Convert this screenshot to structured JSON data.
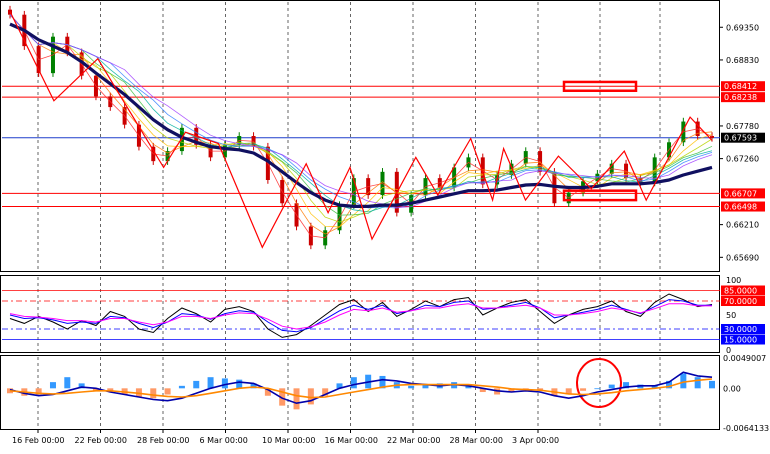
{
  "chart_data": [
    {
      "type": "line",
      "pane": "price",
      "ylim": [
        0.6552,
        0.6972
      ],
      "y_ticks": [
        "0.69350",
        "0.68830",
        "0.67780",
        "0.67260",
        "0.66210",
        "0.65690"
      ],
      "horizontal_levels": [
        {
          "label": "0.68412",
          "value": 0.68412,
          "color": "#ff0000"
        },
        {
          "label": "0.68238",
          "value": 0.68238,
          "color": "#ff0000"
        },
        {
          "label": "0.67593",
          "value": 0.67593,
          "color": "#000000"
        },
        {
          "label": "0.66707",
          "value": 0.66707,
          "color": "#ff0000"
        },
        {
          "label": "0.66498",
          "value": 0.66498,
          "color": "#ff0000"
        }
      ],
      "x": [
        0,
        1,
        2,
        3,
        4,
        5,
        6,
        7,
        8,
        9,
        10,
        11,
        12,
        13,
        14,
        15,
        16,
        17,
        18,
        19,
        20,
        21,
        22,
        23,
        24,
        25,
        26,
        27,
        28,
        29,
        30,
        31,
        32,
        33,
        34,
        35,
        36,
        37,
        38,
        39,
        40,
        41,
        42,
        43,
        44,
        45,
        46,
        47,
        48,
        49
      ],
      "close": [
        0.6955,
        0.6905,
        0.6862,
        0.692,
        0.6895,
        0.6858,
        0.6825,
        0.6808,
        0.678,
        0.6745,
        0.6722,
        0.6738,
        0.6775,
        0.6748,
        0.6728,
        0.6748,
        0.6762,
        0.6745,
        0.6692,
        0.6655,
        0.6618,
        0.6588,
        0.6612,
        0.6652,
        0.6695,
        0.6668,
        0.6705,
        0.664,
        0.6668,
        0.6695,
        0.668,
        0.6712,
        0.6728,
        0.6685,
        0.67,
        0.6718,
        0.6738,
        0.6705,
        0.6655,
        0.6672,
        0.669,
        0.6702,
        0.6718,
        0.6695,
        0.6688,
        0.6728,
        0.6752,
        0.6785,
        0.6762,
        0.6759
      ],
      "series": [
        {
          "values": [
            0.694,
            0.693,
            0.6915,
            0.6905,
            0.6895,
            0.688,
            0.6862,
            0.6845,
            0.6828,
            0.6808,
            0.6788,
            0.6772,
            0.676,
            0.6752,
            0.6745,
            0.6742,
            0.674,
            0.6735,
            0.6722,
            0.6705,
            0.6688,
            0.6672,
            0.666,
            0.6652,
            0.665,
            0.665,
            0.6652,
            0.6652,
            0.6655,
            0.666,
            0.6665,
            0.667,
            0.6675,
            0.6675,
            0.6676,
            0.668,
            0.6684,
            0.6685,
            0.6682,
            0.668,
            0.668,
            0.6682,
            0.6686,
            0.6686,
            0.6686,
            0.6688,
            0.6692,
            0.67,
            0.6706,
            0.6712
          ],
          "color": "#101060"
        }
      ],
      "zigzag": [
        [
          0,
          0.696
        ],
        [
          4,
          0.6818
        ],
        [
          8,
          0.6885
        ],
        [
          14,
          0.6712
        ],
        [
          16,
          0.6768
        ],
        [
          19,
          0.675
        ],
        [
          23,
          0.6585
        ],
        [
          27,
          0.6718
        ],
        [
          29,
          0.664
        ],
        [
          31,
          0.6712
        ],
        [
          33,
          0.6598
        ],
        [
          37,
          0.6728
        ],
        [
          39,
          0.6668
        ],
        [
          42,
          0.6758
        ],
        [
          44,
          0.666
        ],
        [
          45,
          0.6742
        ],
        [
          47,
          0.666
        ],
        [
          50,
          0.673
        ],
        [
          53,
          0.6678
        ],
        [
          56,
          0.6738
        ],
        [
          58,
          0.666
        ],
        [
          62,
          0.6792
        ],
        [
          64,
          0.6755
        ]
      ]
    },
    {
      "type": "line",
      "pane": "oscillator",
      "ylim": [
        0,
        100
      ],
      "y_ticks": [
        "100",
        "50",
        "0"
      ],
      "levels": [
        {
          "label": "85.0000",
          "value": 85
        },
        {
          "label": "70.0000",
          "value": 70
        },
        {
          "label": "30.0000",
          "value": 30
        },
        {
          "label": "15.0000",
          "value": 15
        }
      ],
      "series": [
        {
          "values": [
            45,
            38,
            48,
            40,
            30,
            42,
            35,
            55,
            48,
            30,
            25,
            45,
            60,
            52,
            40,
            58,
            62,
            55,
            30,
            18,
            22,
            35,
            50,
            65,
            72,
            55,
            68,
            48,
            58,
            70,
            62,
            72,
            75,
            50,
            60,
            68,
            72,
            55,
            38,
            50,
            58,
            62,
            70,
            55,
            48,
            68,
            80,
            72,
            62,
            65
          ],
          "color": "#000000"
        },
        {
          "values": [
            50,
            45,
            46,
            43,
            38,
            40,
            38,
            48,
            46,
            38,
            32,
            40,
            52,
            50,
            44,
            52,
            56,
            54,
            40,
            28,
            26,
            32,
            44,
            56,
            64,
            58,
            64,
            52,
            56,
            64,
            62,
            68,
            70,
            58,
            60,
            64,
            68,
            60,
            46,
            50,
            54,
            58,
            64,
            58,
            52,
            62,
            72,
            70,
            64,
            64
          ],
          "color": "#0000ff"
        },
        {
          "values": [
            52,
            48,
            47,
            45,
            42,
            42,
            40,
            45,
            45,
            40,
            36,
            40,
            48,
            48,
            45,
            50,
            53,
            52,
            44,
            34,
            30,
            33,
            40,
            50,
            58,
            56,
            60,
            54,
            56,
            60,
            60,
            64,
            66,
            60,
            60,
            62,
            64,
            60,
            50,
            50,
            52,
            55,
            60,
            57,
            53,
            59,
            66,
            66,
            63,
            63
          ],
          "color": "#ff00ff"
        }
      ]
    },
    {
      "type": "bar",
      "pane": "histogram",
      "ylim": [
        -0.0064133,
        0.0049007
      ],
      "y_ticks": [
        "0.0049007",
        "0.00",
        "-0.0064133"
      ],
      "values": [
        -0.0008,
        -0.0012,
        -0.001,
        0.001,
        0.0018,
        0.0008,
        -0.0004,
        -0.0006,
        -0.001,
        -0.0014,
        -0.0016,
        -0.001,
        0.0004,
        0.0012,
        0.0018,
        0.0016,
        0.0014,
        0.0008,
        -0.0012,
        -0.0028,
        -0.0034,
        -0.0026,
        -0.0012,
        0.0008,
        0.0018,
        0.0022,
        0.002,
        0.001,
        0.0004,
        0.0006,
        0.0008,
        0.001,
        0.0006,
        -0.0006,
        -0.001,
        -0.0006,
        -0.0002,
        -0.0004,
        -0.0012,
        -0.001,
        -0.0004,
        0.0,
        0.0006,
        0.001,
        0.0006,
        0.0004,
        0.0012,
        0.0024,
        0.0018,
        0.0012
      ],
      "series": [
        {
          "values": [
            -0.0002,
            -0.0008,
            -0.0012,
            -0.001,
            -0.0004,
            0.0002,
            0.0,
            -0.0006,
            -0.001,
            -0.0014,
            -0.0018,
            -0.002,
            -0.0016,
            -0.0008,
            0.0,
            0.0006,
            0.001,
            0.0008,
            -0.0002,
            -0.0016,
            -0.0024,
            -0.002,
            -0.001,
            0.0,
            0.0006,
            0.001,
            0.0014,
            0.0012,
            0.0008,
            0.0006,
            0.0004,
            0.0006,
            0.0004,
            0.0,
            -0.0004,
            -0.0006,
            -0.0004,
            -0.0006,
            -0.0012,
            -0.0016,
            -0.0012,
            -0.0006,
            -0.0002,
            0.0002,
            0.0004,
            0.0004,
            0.001,
            0.0026,
            0.002,
            0.0018
          ],
          "color": "#0000aa"
        },
        {
          "values": [
            -0.0004,
            -0.0006,
            -0.0008,
            -0.0009,
            -0.0008,
            -0.0006,
            -0.0004,
            -0.0004,
            -0.0006,
            -0.0008,
            -0.0011,
            -0.0013,
            -0.0014,
            -0.0012,
            -0.0008,
            -0.0004,
            0.0,
            0.0002,
            0.0,
            -0.0006,
            -0.0012,
            -0.0015,
            -0.0014,
            -0.001,
            -0.0006,
            -0.0002,
            0.0002,
            0.0005,
            0.0006,
            0.0006,
            0.0006,
            0.0006,
            0.0006,
            0.0004,
            0.0002,
            -0.0001,
            -0.0002,
            -0.0003,
            -0.0006,
            -0.0009,
            -0.001,
            -0.0009,
            -0.0007,
            -0.0004,
            -0.0002,
            0.0,
            0.0003,
            0.001,
            0.0013,
            0.0015
          ],
          "color": "#ff8800"
        }
      ]
    }
  ],
  "x_axis": {
    "labels": [
      "16 Feb 00:00",
      "22 Feb 00:00",
      "28 Feb 00:00",
      "6 Mar 00:00",
      "10 Mar 00:00",
      "16 Mar 00:00",
      "22 Mar 00:00",
      "28 Mar 00:00",
      "3 Apr 00:00"
    ]
  },
  "colors": {
    "level_red": "#ff0000",
    "current_price_line": "#1f3fcc",
    "bull_candle": "#008000",
    "bear_candle": "#cc0000",
    "histogram_positive": "#3399ff",
    "histogram_negative": "#ff9966",
    "annotation_red": "#ff0000"
  }
}
